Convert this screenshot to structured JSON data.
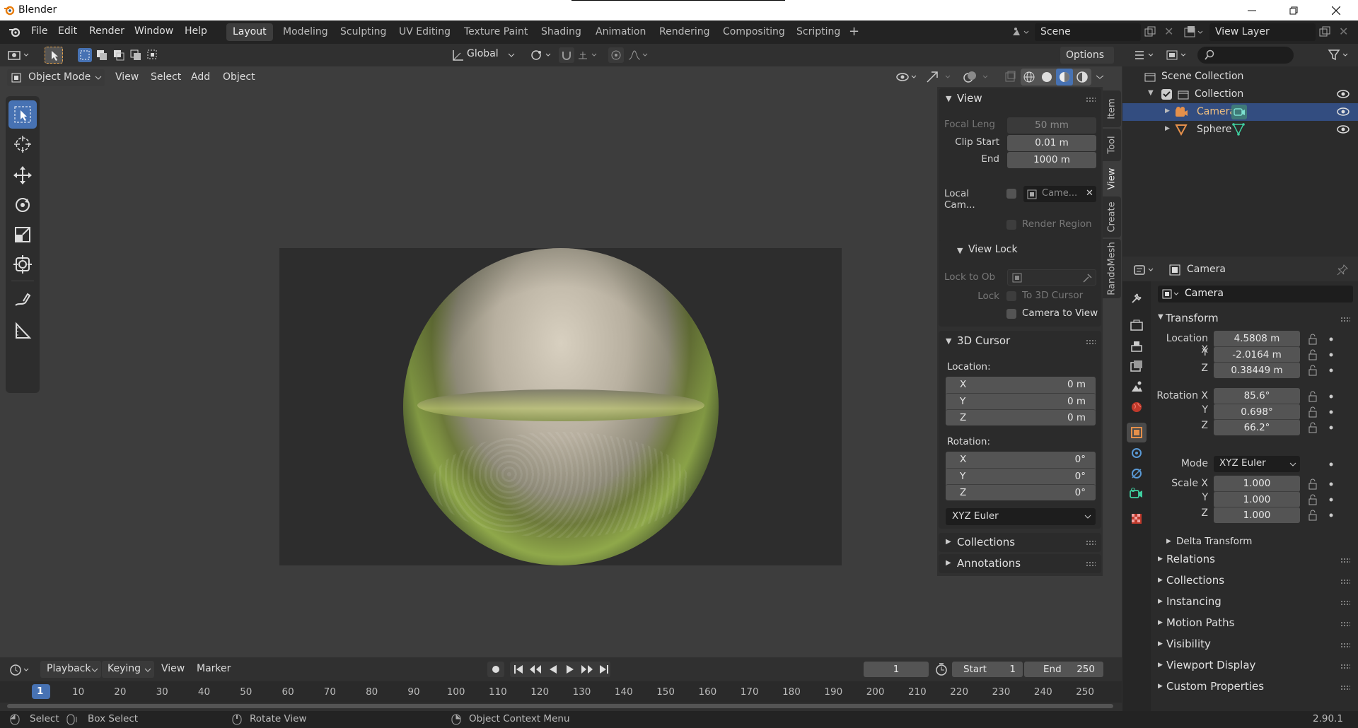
{
  "app": {
    "title": "Blender",
    "version": "2.90.1"
  },
  "menu": [
    "File",
    "Edit",
    "Render",
    "Window",
    "Help"
  ],
  "workspaces": [
    {
      "label": "Layout",
      "active": true
    },
    {
      "label": "Modeling"
    },
    {
      "label": "Sculpting"
    },
    {
      "label": "UV Editing"
    },
    {
      "label": "Texture Paint"
    },
    {
      "label": "Shading"
    },
    {
      "label": "Animation"
    },
    {
      "label": "Rendering"
    },
    {
      "label": "Compositing"
    },
    {
      "label": "Scripting"
    }
  ],
  "scene": {
    "name": "Scene",
    "view_layer": "View Layer"
  },
  "viewport": {
    "transform_orientation": "Global",
    "options": "Options",
    "mode": "Object Mode",
    "menus": [
      "View",
      "Select",
      "Add",
      "Object"
    ]
  },
  "npanel": {
    "tabs": [
      "Item",
      "Tool",
      "View",
      "Create",
      "RandoMesh"
    ],
    "view": {
      "title": "View",
      "focal_label": "Focal Leng",
      "focal": "50 mm",
      "clip_start_label": "Clip Start",
      "clip_start": "0.01 m",
      "end_label": "End",
      "clip_end": "1000 m",
      "local_cam_label": "Local Cam...",
      "local_cam": "Came...",
      "render_region": "Render Region"
    },
    "view_lock": {
      "title": "View Lock",
      "lock_to_ob": "Lock to Ob",
      "lock": "Lock",
      "to_3d_cursor": "To 3D Cursor",
      "camera_to_view": "Camera to View"
    },
    "cursor": {
      "title": "3D Cursor",
      "location_label": "Location:",
      "rotation_label": "Rotation:",
      "location": [
        {
          "axis": "X",
          "value": "0 m"
        },
        {
          "axis": "Y",
          "value": "0 m"
        },
        {
          "axis": "Z",
          "value": "0 m"
        }
      ],
      "rotation": [
        {
          "axis": "X",
          "value": "0°"
        },
        {
          "axis": "Y",
          "value": "0°"
        },
        {
          "axis": "Z",
          "value": "0°"
        }
      ],
      "mode": "XYZ Euler"
    },
    "collections": "Collections",
    "annotations": "Annotations"
  },
  "outliner": {
    "scene_collection": "Scene Collection",
    "collection": "Collection",
    "items": [
      "Camera",
      "Sphere"
    ]
  },
  "properties": {
    "header": "Camera",
    "object_name": "Camera",
    "transform": "Transform",
    "location": {
      "label": "Location X",
      "x": "4.5808 m",
      "y": "-2.0164 m",
      "z": "0.38449 m"
    },
    "rotation": {
      "label": "Rotation X",
      "x": "85.6°",
      "y": "0.698°",
      "z": "66.2°"
    },
    "mode_label": "Mode",
    "mode": "XYZ Euler",
    "scale": {
      "label": "Scale X",
      "x": "1.000",
      "y": "1.000",
      "z": "1.000"
    },
    "axis_y": "Y",
    "axis_z": "Z",
    "delta": "Delta Transform",
    "sections": [
      "Relations",
      "Collections",
      "Instancing",
      "Motion Paths",
      "Visibility",
      "Viewport Display",
      "Custom Properties"
    ]
  },
  "timeline": {
    "menus": [
      "Playback",
      "Keying",
      "View",
      "Marker"
    ],
    "current_frame": "1",
    "start_label": "Start",
    "start": "1",
    "end_label": "End",
    "end": "250",
    "ruler": [
      "1",
      "10",
      "20",
      "30",
      "40",
      "50",
      "60",
      "70",
      "80",
      "90",
      "100",
      "110",
      "120",
      "130",
      "140",
      "150",
      "160",
      "170",
      "180",
      "190",
      "200",
      "210",
      "220",
      "230",
      "240",
      "250"
    ]
  },
  "status": {
    "select": "Select",
    "box_select": "Box Select",
    "rotate_view": "Rotate View",
    "context_menu": "Object Context Menu"
  },
  "colors": {
    "accent": "#4772b3",
    "selection": "#334d80",
    "active_tool": "#4772b3",
    "camera_orange": "#e5904b"
  }
}
